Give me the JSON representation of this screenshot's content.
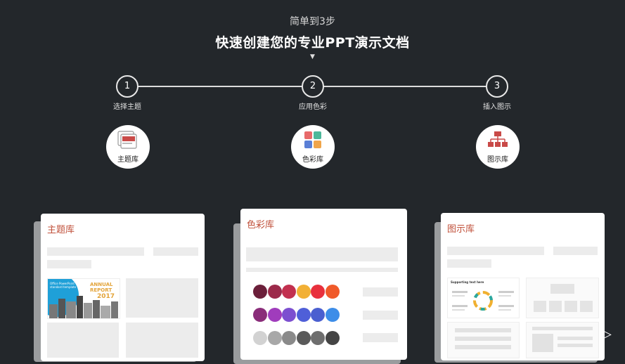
{
  "header": {
    "subtitle": "简单到3步",
    "title": "快速创建您的专业PPT演示文档",
    "arrow_glyph": "▼"
  },
  "steps": [
    {
      "number": "1",
      "label": "选择主题"
    },
    {
      "number": "2",
      "label": "应用色彩"
    },
    {
      "number": "3",
      "label": "插入图示"
    }
  ],
  "libraries": [
    {
      "label": "主题库",
      "icon": "theme-library-icon"
    },
    {
      "label": "色彩库",
      "icon": "color-library-icon"
    },
    {
      "label": "图示库",
      "icon": "diagram-library-icon"
    }
  ],
  "cards": {
    "theme": {
      "title": "主题库",
      "thumb_title": "Office PowerPoint\nstandard template",
      "thumb_report": "ANNUAL\nREPORT",
      "thumb_year": "2017"
    },
    "color": {
      "title": "色彩库"
    },
    "diagram": {
      "title": "图示库",
      "thumb_title": "Supporting text here"
    }
  },
  "colors": {
    "accent": "#c0503a",
    "background": "#23272b",
    "swatch_rows": [
      [
        "#6b1f3a",
        "#9c2a4a",
        "#c2304f",
        "#f2b035",
        "#e8303d",
        "#f05a2a"
      ],
      [
        "#8a2d7a",
        "#a03cbc",
        "#7c4fd0",
        "#4f5fd8",
        "#4a5fd0",
        "#3d8de8"
      ],
      [
        "#d2d2d2",
        "#a8a8a8",
        "#8a8a8a",
        "#5a5a5a",
        "#6e6e6e",
        "#444444"
      ]
    ]
  },
  "nav": {
    "next_icon": "play-arrow-icon",
    "next_glyph": "▷"
  }
}
